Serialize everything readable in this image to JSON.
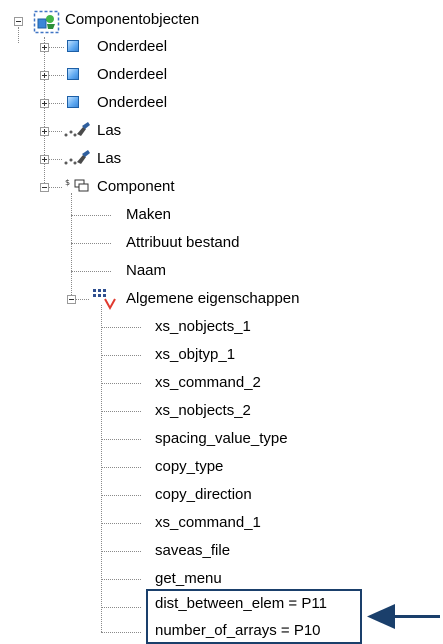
{
  "tree": {
    "root_label": "Componentobjecten",
    "parts": [
      "Onderdeel",
      "Onderdeel",
      "Onderdeel"
    ],
    "welds": [
      "Las",
      "Las"
    ],
    "component": {
      "label": "Component",
      "children": [
        "Maken",
        "Attribuut bestand",
        "Naam"
      ],
      "general_properties": {
        "label": "Algemene eigenschappen",
        "items": [
          "xs_nobjects_1",
          "xs_objtyp_1",
          "xs_command_2",
          "xs_nobjects_2",
          "spacing_value_type",
          "copy_type",
          "copy_direction",
          "xs_command_1",
          "saveas_file",
          "get_menu",
          "dist_between_elem = P11",
          "number_of_arrays = P10"
        ]
      }
    }
  },
  "colors": {
    "highlight": "#1a3f6b",
    "part_icon": "#3a86d8"
  },
  "icons": [
    "expand-icon",
    "collapse-icon",
    "component-objects-icon",
    "part-icon",
    "weld-icon",
    "component-icon",
    "properties-icon"
  ]
}
